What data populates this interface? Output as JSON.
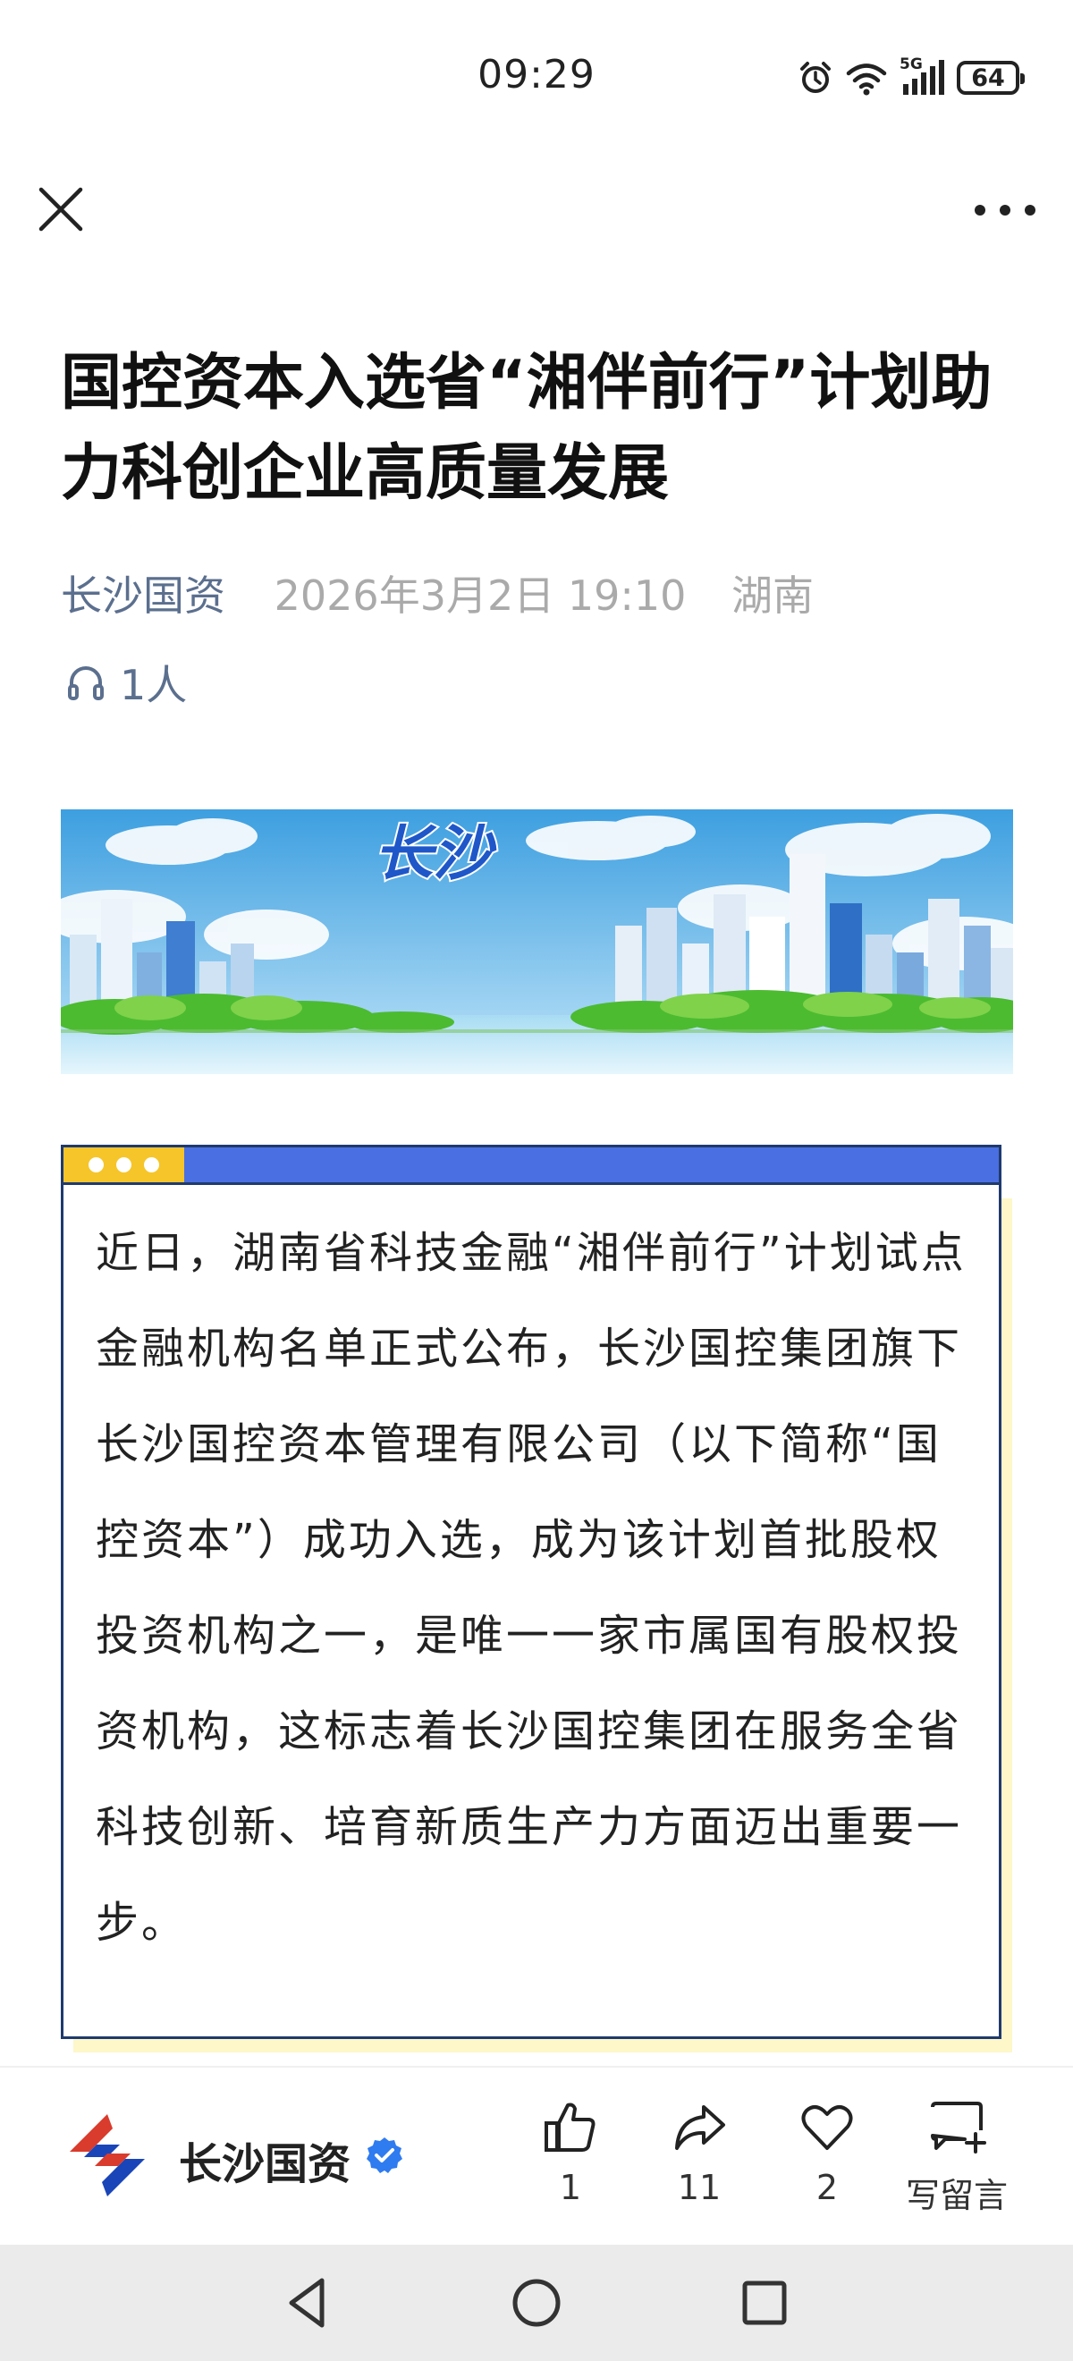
{
  "status_bar": {
    "time": "09:29",
    "battery": "64",
    "network": "5G",
    "icons": [
      "alarm-icon",
      "wifi-icon",
      "signal-icon",
      "battery-icon"
    ]
  },
  "top_nav": {
    "close_icon": "close-icon",
    "more_icon": "more-dots-icon"
  },
  "article": {
    "title": "国控资本入选省“湘伴前行”计划助力科创企业高质量发展",
    "source": "长沙国资",
    "date": "2026年3月2日 19:10",
    "location": "湖南",
    "listeners": "1人",
    "banner_text": "长沙",
    "body": "近日，湖南省科技金融“湘伴前行”计划试点金融机构名单正式公布，长沙国控集团旗下长沙国控资本管理有限公司（以下简称“国控资本”）成功入选，成为该计划首批股权投资机构之一，是唯一一家市属国有股权投资机构，这标志着长沙国控集团在服务全省科技创新、培育新质生产力方面迈出重要一步。"
  },
  "action_bar": {
    "account_name": "长沙国资",
    "like_count": "1",
    "share_count": "11",
    "favorite_count": "2",
    "comment_label": "写留言"
  },
  "colors": {
    "source": "#5b6f8e",
    "card_border": "#1f3a6e",
    "card_topbar": "#4a6fe2",
    "card_dots": "#f5c52a",
    "card_shadow": "#fdf7c9",
    "verified": "#2f7bf0"
  }
}
